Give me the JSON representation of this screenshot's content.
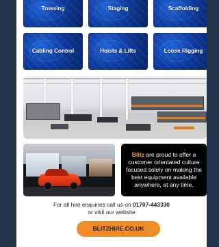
{
  "categories": [
    {
      "label": "Trussing"
    },
    {
      "label": "Staging"
    },
    {
      "label": "Scaffolding"
    },
    {
      "label": "Cabling Control"
    },
    {
      "label": "Hoists & Lifts"
    },
    {
      "label": "Loose Rigging"
    }
  ],
  "promo": {
    "brand": "Blitz",
    "text": " are proud to offer a customer orientated culture focused solely on making the best equipment available anywhere, at any time."
  },
  "contact": {
    "line1_prefix": "For all hire enquiries call us on ",
    "phone": "01707-443330",
    "line2": "or visit our website"
  },
  "cta": {
    "label": "BLITZHIRE.CO.UK"
  },
  "colors": {
    "sidebar": "#243447",
    "tile_blue": "#0d3a9e",
    "accent_orange": "#ef8c28",
    "brand_text": "#f2a73b"
  }
}
